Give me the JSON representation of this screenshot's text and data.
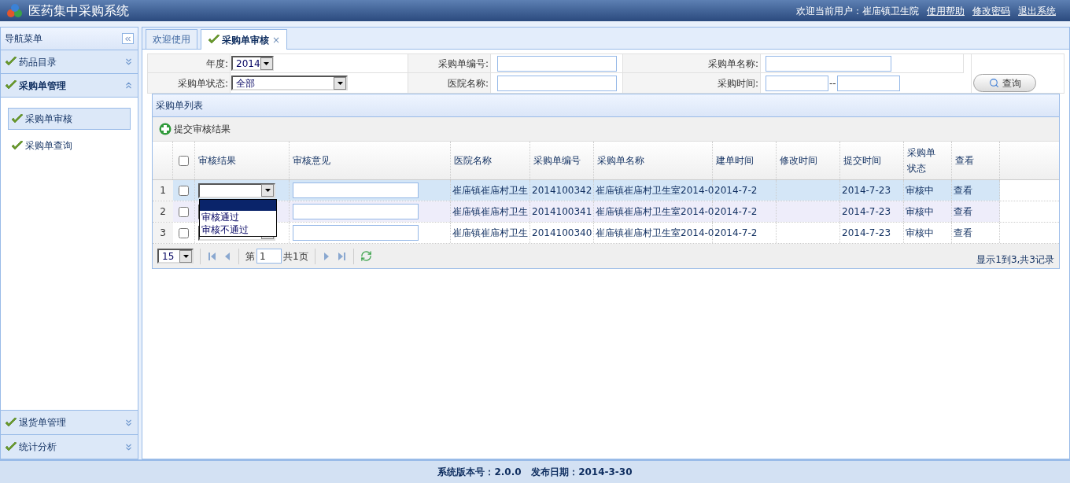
{
  "header": {
    "title": "医药集中采购系统",
    "welcome": "欢迎当前用户：崔庙镇卫生院",
    "links": [
      "使用帮助",
      "修改密码",
      "退出系统"
    ]
  },
  "sidebar": {
    "title": "导航菜单",
    "top_sections": [
      {
        "label": "药品目录",
        "expanded": false
      },
      {
        "label": "采购单管理",
        "expanded": true,
        "items": [
          {
            "label": "采购单审核",
            "selected": true
          },
          {
            "label": "采购单查询",
            "selected": false
          }
        ]
      }
    ],
    "bottom_sections": [
      {
        "label": "退货单管理",
        "expanded": false
      },
      {
        "label": "统计分析",
        "expanded": false
      }
    ]
  },
  "tabs": [
    {
      "label": "欢迎使用",
      "selected": false,
      "closable": false,
      "icon": false
    },
    {
      "label": "采购单审核",
      "selected": true,
      "closable": true,
      "icon": true
    }
  ],
  "close_glyph": "×",
  "search": {
    "year_label": "年度:",
    "year_value": "2014",
    "order_no_label": "采购单编号:",
    "order_name_label": "采购单名称:",
    "status_label": "采购单状态:",
    "status_value": "全部",
    "hospital_label": "医院名称:",
    "time_label": "采购时间:",
    "time_sep": "--",
    "query_button": "查询"
  },
  "grid": {
    "title": "采购单列表",
    "toolbar_button": "提交审核结果",
    "columns": [
      "审核结果",
      "审核意见",
      "医院名称",
      "采购单编号",
      "采购单名称",
      "建单时间",
      "修改时间",
      "提交时间",
      "采购单状态",
      "查看"
    ],
    "header_checked": false,
    "rows": [
      {
        "number": "1",
        "checked": false,
        "selected": true,
        "hospital": "崔庙镇崔庙村卫生",
        "order_no": "2014100342",
        "order_name": "崔庙镇崔庙村卫生室2014-0",
        "created": "2014-7-2",
        "submitted": "2014-7-23",
        "status": "审核中",
        "view": "查看"
      },
      {
        "number": "2",
        "checked": false,
        "selected": false,
        "hospital": "崔庙镇崔庙村卫生",
        "order_no": "2014100341",
        "order_name": "崔庙镇崔庙村卫生室2014-0",
        "created": "2014-7-2",
        "submitted": "2014-7-23",
        "status": "审核中",
        "view": "查看"
      },
      {
        "number": "3",
        "checked": false,
        "selected": false,
        "hospital": "崔庙镇崔庙村卫生",
        "order_no": "2014100340",
        "order_name": "崔庙镇崔庙村卫生室2014-0",
        "created": "2014-7-2",
        "submitted": "2014-7-23",
        "status": "审核中",
        "view": "查看"
      }
    ],
    "dropdown": {
      "open": true,
      "blank_highlighted": true,
      "options": [
        "审核通过",
        "审核不通过"
      ]
    }
  },
  "pager": {
    "page_size": "15",
    "page_prefix": "第",
    "page": "1",
    "page_total": "共1页",
    "summary": "显示1到3,共3记录"
  },
  "footer": {
    "text": "系统版本号：2.0.0   发布日期：2014-3-30"
  }
}
